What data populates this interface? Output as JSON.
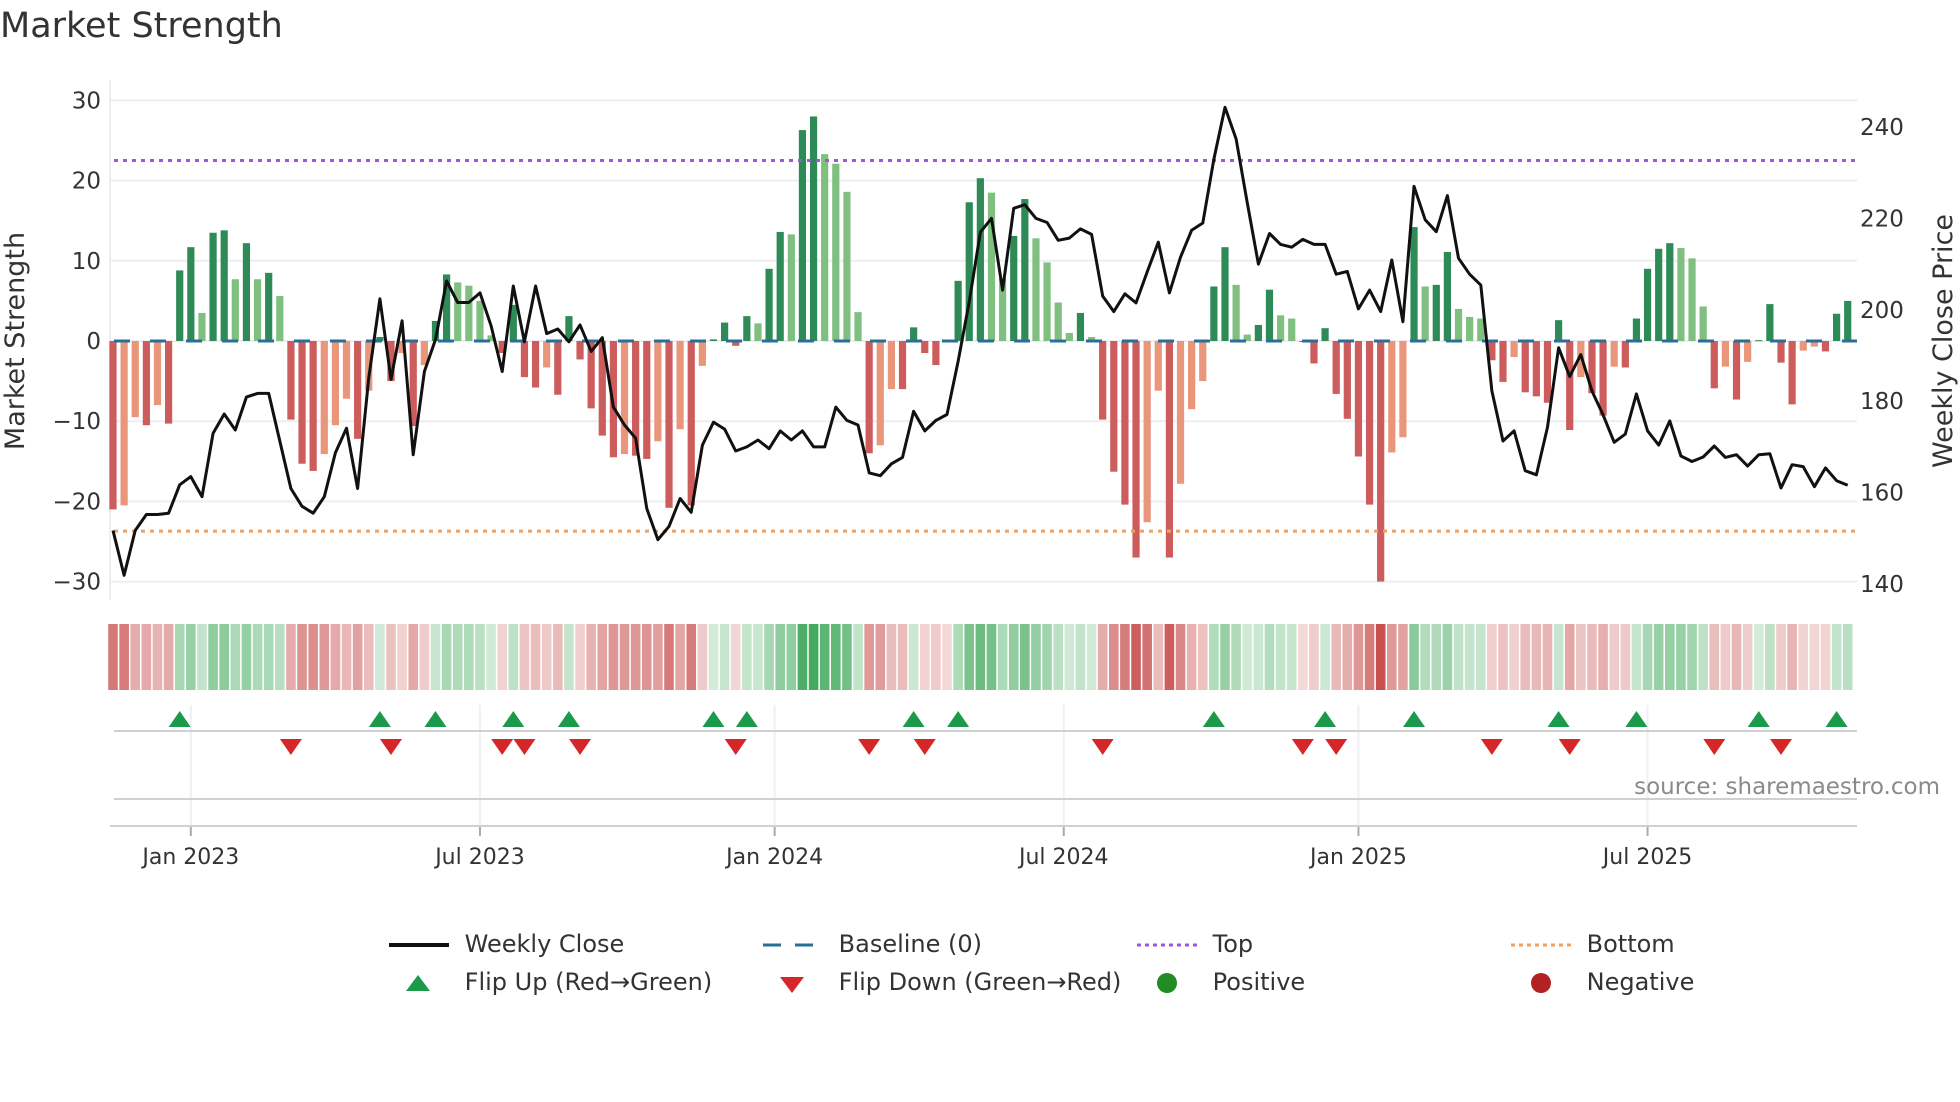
{
  "title": "Market Strength",
  "source": "source: sharemaestro.com",
  "legend": {
    "weekly_close": "Weekly Close",
    "baseline": "Baseline (0)",
    "top": "Top",
    "bottom": "Bottom",
    "flip_up": "Flip Up (Red→Green)",
    "flip_down": "Flip Down (Green→Red)",
    "positive": "Positive",
    "negative": "Negative"
  },
  "colors": {
    "rising_positive": "#2e8b57",
    "falling_positive": "#7fbf7f",
    "falling_negative": "#cd5c5c",
    "rising_negative": "#e9967a",
    "weekly_close": "#111111",
    "baseline": "#2a6f97",
    "top": "#9b59d9",
    "bottom": "#f0a060",
    "flip_up": "#1a9a4a",
    "flip_down": "#d62728",
    "positive": "#228b22",
    "negative": "#b22222"
  },
  "chart_data": {
    "type": "bar",
    "title": "Market Strength",
    "ylabel": "Market Strength",
    "ylabel_right": "Weekly Close Price",
    "ylim": [
      -32,
      33
    ],
    "yticks": [
      -30,
      -20,
      -10,
      0,
      10,
      20,
      30
    ],
    "ylim_right": [
      135,
      248
    ],
    "yticks_right": [
      140,
      160,
      180,
      200,
      220,
      240
    ],
    "xtick_labels": [
      "Jan 2023",
      "Jul 2023",
      "Jan 2024",
      "Jul 2024",
      "Jan 2025",
      "Jul 2025"
    ],
    "xtick_week_index": [
      7,
      33,
      59.5,
      85.5,
      112,
      138
    ],
    "top_level": 22.5,
    "bottom_level": -23.7,
    "frequency": "weekly",
    "strength": [
      -21,
      -20.5,
      -9.5,
      -10.5,
      -8,
      -10.3,
      8.8,
      11.7,
      3.5,
      13.5,
      13.8,
      7.7,
      12.2,
      7.7,
      8.5,
      5.6,
      -9.8,
      -15.3,
      -16.2,
      -14.1,
      -10.5,
      -7.2,
      -12.2,
      -6.2,
      0.5,
      -5,
      -1.5,
      -10.6,
      -3,
      2.5,
      8.3,
      7.3,
      6.9,
      5,
      0.7,
      -1.5,
      4.5,
      -4.5,
      -5.8,
      -3.3,
      -6.7,
      3.1,
      -2.3,
      -8.4,
      -11.8,
      -14.5,
      -14.1,
      -14.3,
      -14.7,
      -12.5,
      -20.8,
      -11,
      -20.5,
      -3.1,
      0.2,
      2.3,
      -0.6,
      3.1,
      2.2,
      9,
      13.6,
      13.3,
      26.3,
      28,
      23.3,
      22.1,
      18.6,
      3.6,
      -14,
      -13,
      -6,
      -6,
      1.7,
      -1.5,
      -3,
      -0.1,
      7.5,
      17.3,
      20.3,
      18.5,
      7.8,
      13.1,
      17.7,
      12.8,
      9.8,
      4.8,
      1.0,
      3.5,
      0.5,
      -9.8,
      -16.3,
      -20.4,
      -27,
      -22.6,
      -6.2,
      -27,
      -17.8,
      -8.5,
      -5,
      6.8,
      11.7,
      7,
      0.8,
      2,
      6.4,
      3.2,
      2.8,
      -0.1,
      -2.8,
      1.6,
      -6.6,
      -9.7,
      -14.4,
      -20.4,
      -30,
      -13.9,
      -12,
      14.2,
      6.8,
      7,
      11.1,
      4,
      3,
      2.8,
      -2.4,
      -5.1,
      -2,
      -6.4,
      -6.9,
      -7.7,
      2.6,
      -11.1,
      -4.5,
      -6.5,
      -9.3,
      -3.2,
      -3.3,
      2.8,
      9,
      11.5,
      12.2,
      11.6,
      10.3,
      4.3,
      -5.9,
      -3.2,
      -7.3,
      -2.6,
      0.1,
      4.6,
      -2.7,
      -7.9,
      -1.2,
      -0.7,
      -1.3,
      3.4,
      5
    ],
    "weekly_close": [
      151.7,
      141.9,
      151.7,
      155.2,
      155.2,
      155.5,
      161.7,
      163.5,
      159.1,
      173,
      177.2,
      173.7,
      180.9,
      181.7,
      181.7,
      171.3,
      160.9,
      157,
      155.5,
      159.1,
      168.7,
      174.1,
      160.9,
      185.2,
      202.4,
      184.8,
      197.6,
      168.3,
      186.5,
      193.5,
      206.3,
      201.6,
      201.6,
      203.7,
      196.5,
      186.5,
      205.2,
      193,
      205.2,
      194.8,
      195.8,
      193,
      196.7,
      190.9,
      193.9,
      178.7,
      174.8,
      171.9,
      156.5,
      149.7,
      152.6,
      158.7,
      155.7,
      170.4,
      175.4,
      173.9,
      169.1,
      170,
      171.5,
      169.6,
      173.5,
      171.5,
      173.5,
      170,
      170,
      178.7,
      175.8,
      174.8,
      164.3,
      163.7,
      166.3,
      167.7,
      177.8,
      173.5,
      175.8,
      177.1,
      188.7,
      201.7,
      217,
      220,
      204.3,
      222.2,
      223,
      220,
      219.1,
      215.2,
      215.7,
      217.7,
      216.5,
      203,
      199.6,
      203.5,
      201.5,
      208.3,
      214.8,
      203.7,
      211.5,
      217.4,
      219,
      233,
      244.3,
      237.4,
      223.5,
      210,
      216.7,
      214.3,
      213.7,
      215.4,
      214.3,
      214.3,
      207.8,
      208.4,
      200.2,
      204.3,
      199.6,
      210.9,
      197.4,
      227,
      219.7,
      217.1,
      225,
      211.3,
      207.8,
      205.4,
      182.2,
      171.3,
      173.5,
      164.8,
      163.9,
      174.3,
      191.7,
      185.4,
      190.2,
      182.2,
      177,
      171,
      172.8,
      181.6,
      173.5,
      170.4,
      175.7,
      168,
      166.8,
      167.8,
      170.2,
      167.7,
      168.3,
      165.8,
      168.3,
      168.5,
      161,
      166.1,
      165.7,
      161.3,
      165.4,
      162.6,
      161.6
    ],
    "flip_up_weeks": [
      6,
      24,
      29,
      36,
      41,
      54,
      57,
      72,
      76,
      99,
      109,
      117,
      130,
      137,
      148,
      155
    ],
    "flip_down_weeks": [
      16,
      25,
      35,
      37,
      42,
      56,
      68,
      73,
      89,
      107,
      110,
      124,
      131,
      144,
      150
    ]
  }
}
